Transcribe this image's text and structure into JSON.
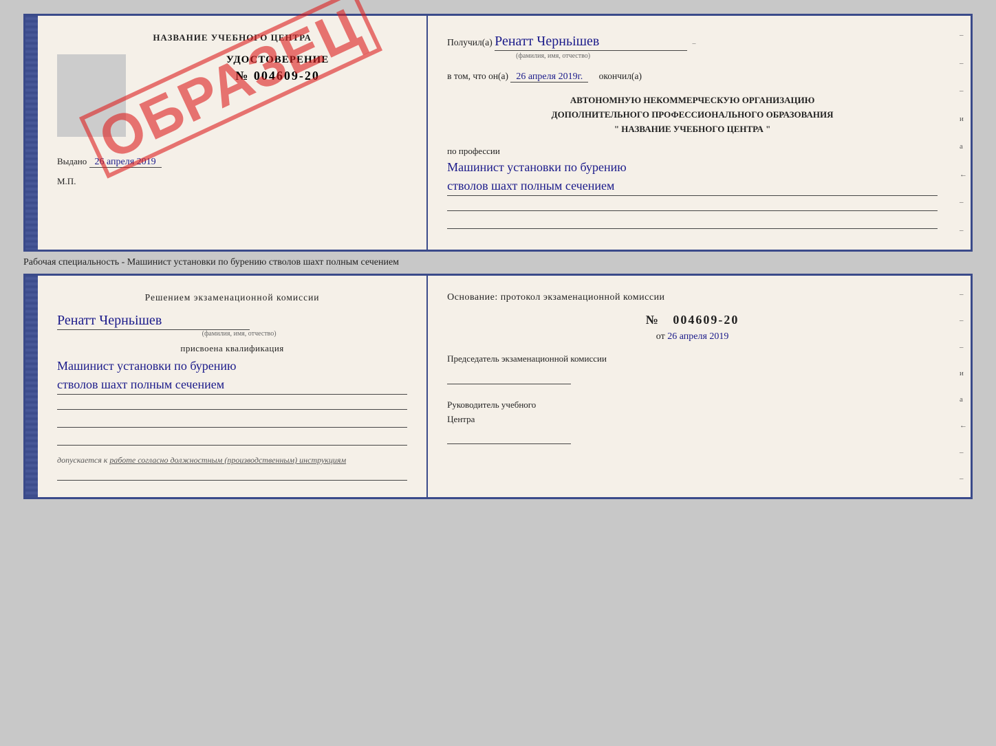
{
  "cert_top": {
    "left": {
      "title": "НАЗВАНИЕ УЧЕБНОГО ЦЕНТРА",
      "doc_label": "УДОСТОВЕРЕНИЕ",
      "doc_number": "№ 004609-20",
      "stamp": "ОБРАЗЕЦ",
      "issued_label": "Выдано",
      "issued_date": "26 апреля 2019",
      "mp": "М.П."
    },
    "right": {
      "received_label": "Получил(а)",
      "name_handwritten": "Ренатт Черньішев",
      "name_sublabel": "(фамилия, имя, отчество)",
      "in_that_label": "в том, что он(а)",
      "date_handwritten": "26 апреля 2019г.",
      "finished_label": "окончил(а)",
      "org_line1": "АВТОНОМНУЮ НЕКОММЕРЧЕСКУЮ ОРГАНИЗАЦИЮ",
      "org_line2": "ДОПОЛНИТЕЛЬНОГО ПРОФЕССИОНАЛЬНОГО ОБРАЗОВАНИЯ",
      "org_line3": "\" НАЗВАНИЕ УЧЕБНОГО ЦЕНТРА \"",
      "profession_label": "по профессии",
      "profession_handwritten_line1": "Машинист установки по бурению",
      "profession_handwritten_line2": "стволов шахт полным сечением"
    }
  },
  "description": "Рабочая специальность - Машинист установки по бурению стволов шахт полным сечением",
  "cert_bottom": {
    "left": {
      "decision_label": "Решением экзаменационной комиссии",
      "name_handwritten": "Ренатт Черньішев",
      "name_sublabel": "(фамилия, имя, отчество)",
      "qualification_label": "присвоена квалификация",
      "qualification_handwritten_line1": "Машинист установки по бурению",
      "qualification_handwritten_line2": "стволов шахт полным сечением",
      "допускается_label": "допускается к",
      "допускается_text": "работе согласно должностным (производственным) инструкциям"
    },
    "right": {
      "base_label": "Основание: протокол экзаменационной комиссии",
      "number_label": "№",
      "number": "004609-20",
      "date_prefix": "от",
      "date": "26 апреля 2019",
      "chairman_label": "Председатель экзаменационной комиссии",
      "head_label_line1": "Руководитель учебного",
      "head_label_line2": "Центра"
    }
  },
  "side_marks": [
    "-",
    "-",
    "-",
    "и",
    "а",
    "←",
    "-",
    "-",
    "-"
  ]
}
